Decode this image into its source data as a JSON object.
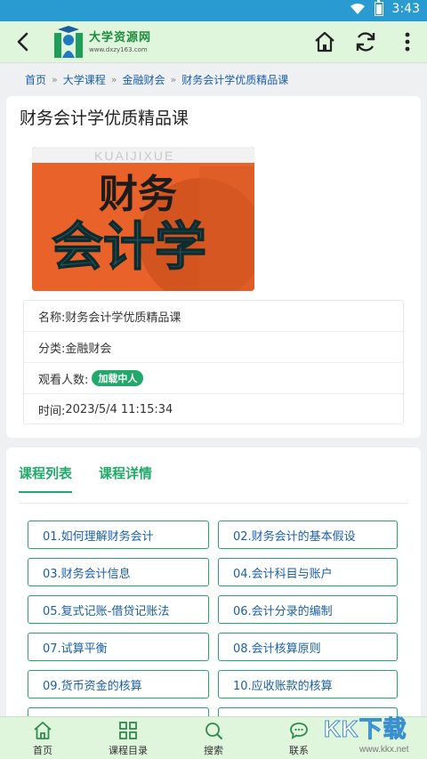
{
  "status_bar": {
    "time": "3:43"
  },
  "app_bar": {
    "logo_title": "大学资源网",
    "logo_url": "www.dxzy163.com"
  },
  "breadcrumb": {
    "items": [
      "首页",
      "大学课程",
      "金融财会",
      "财务会计学优质精品课"
    ],
    "separator": "»"
  },
  "course": {
    "title": "财务会计学优质精品课",
    "cover": {
      "pinyin": "KUAIJIXUE",
      "line1": "财务",
      "line2": "会计学",
      "bg_color": "#e8622a"
    },
    "info": {
      "name_label": "名称:",
      "name_value": "财务会计学优质精品课",
      "category_label": "分类:",
      "category_value": "金融财会",
      "viewers_label": "观看人数:",
      "viewers_value": "加载中人",
      "time_label": "时间:",
      "time_value": "2023/5/4 11:15:34"
    }
  },
  "tabs": [
    "课程列表",
    "课程详情"
  ],
  "lessons": [
    "01.如何理解财务会计",
    "02.财务会计的基本假设",
    "03.财务会计信息",
    "04.会计科目与账户",
    "05.复式记账-借贷记账法",
    "06.会计分录的编制",
    "07.试算平衡",
    "08.会计核算原则",
    "09.货币资金的核算",
    "10.应收账款的核算"
  ],
  "bottom_nav": [
    "首页",
    "课程目录",
    "搜索",
    "联系"
  ],
  "watermark": {
    "big": "KK下载",
    "small": "www.kkx.net"
  },
  "colors": {
    "accent": "#23a86b",
    "appbar": "#dff5dc",
    "statusbar": "#2a9bd0",
    "link": "#1a5fa8"
  }
}
